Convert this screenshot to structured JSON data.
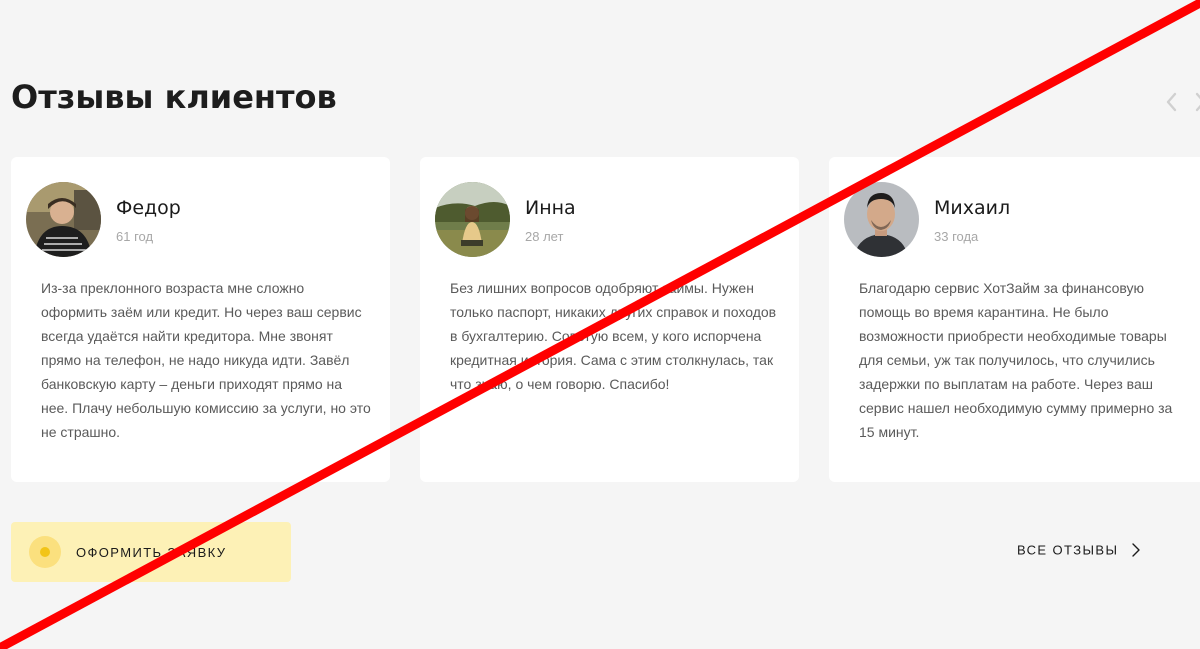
{
  "section": {
    "title": "Отзывы клиентов"
  },
  "carousel": {
    "prev_icon": "chevron-left-icon",
    "next_icon": "chevron-right-icon"
  },
  "reviews": [
    {
      "name": "Федор",
      "age": "61 год",
      "text": "Из-за преклонного возраста мне сложно оформить заём или кредит. Но через ваш сервис всегда удаётся найти кредитора. Мне звонят прямо на телефон, не надо никуда идти. Завёл банковскую карту – деньги приходят прямо на нее. Плачу небольшую комиссию за услуги, но это не страшно."
    },
    {
      "name": "Инна",
      "age": "28 лет",
      "text": "Без лишних вопросов одобряют займы. Нужен только паспорт, никаких других справок и походов в бухгалтерию. Советую всем, у кого испорчена кредитная история. Сама с этим столкнулась, так что знаю, о чем говорю. Спасибо!"
    },
    {
      "name": "Михаил",
      "age": "33 года",
      "text": "Благодарю сервис ХотЗайм за финансовую помощь во время карантина. Не было возможности приобрести необходимые товары для семьи, уж так получилось, что случились задержки по выплатам на работе. Через ваш сервис нашел необходимую сумму примерно за 15 минут."
    }
  ],
  "actions": {
    "apply_label": "ОФОРМИТЬ ЗАЯВКУ",
    "all_reviews_label": "ВСЕ ОТЗЫВЫ",
    "all_reviews_icon": "chevron-right-icon"
  },
  "colors": {
    "background": "#f5f5f5",
    "card": "#ffffff",
    "button_bg": "#fdf1b6",
    "accent_yellow": "#f2c417",
    "strike_line": "#ff0000"
  }
}
